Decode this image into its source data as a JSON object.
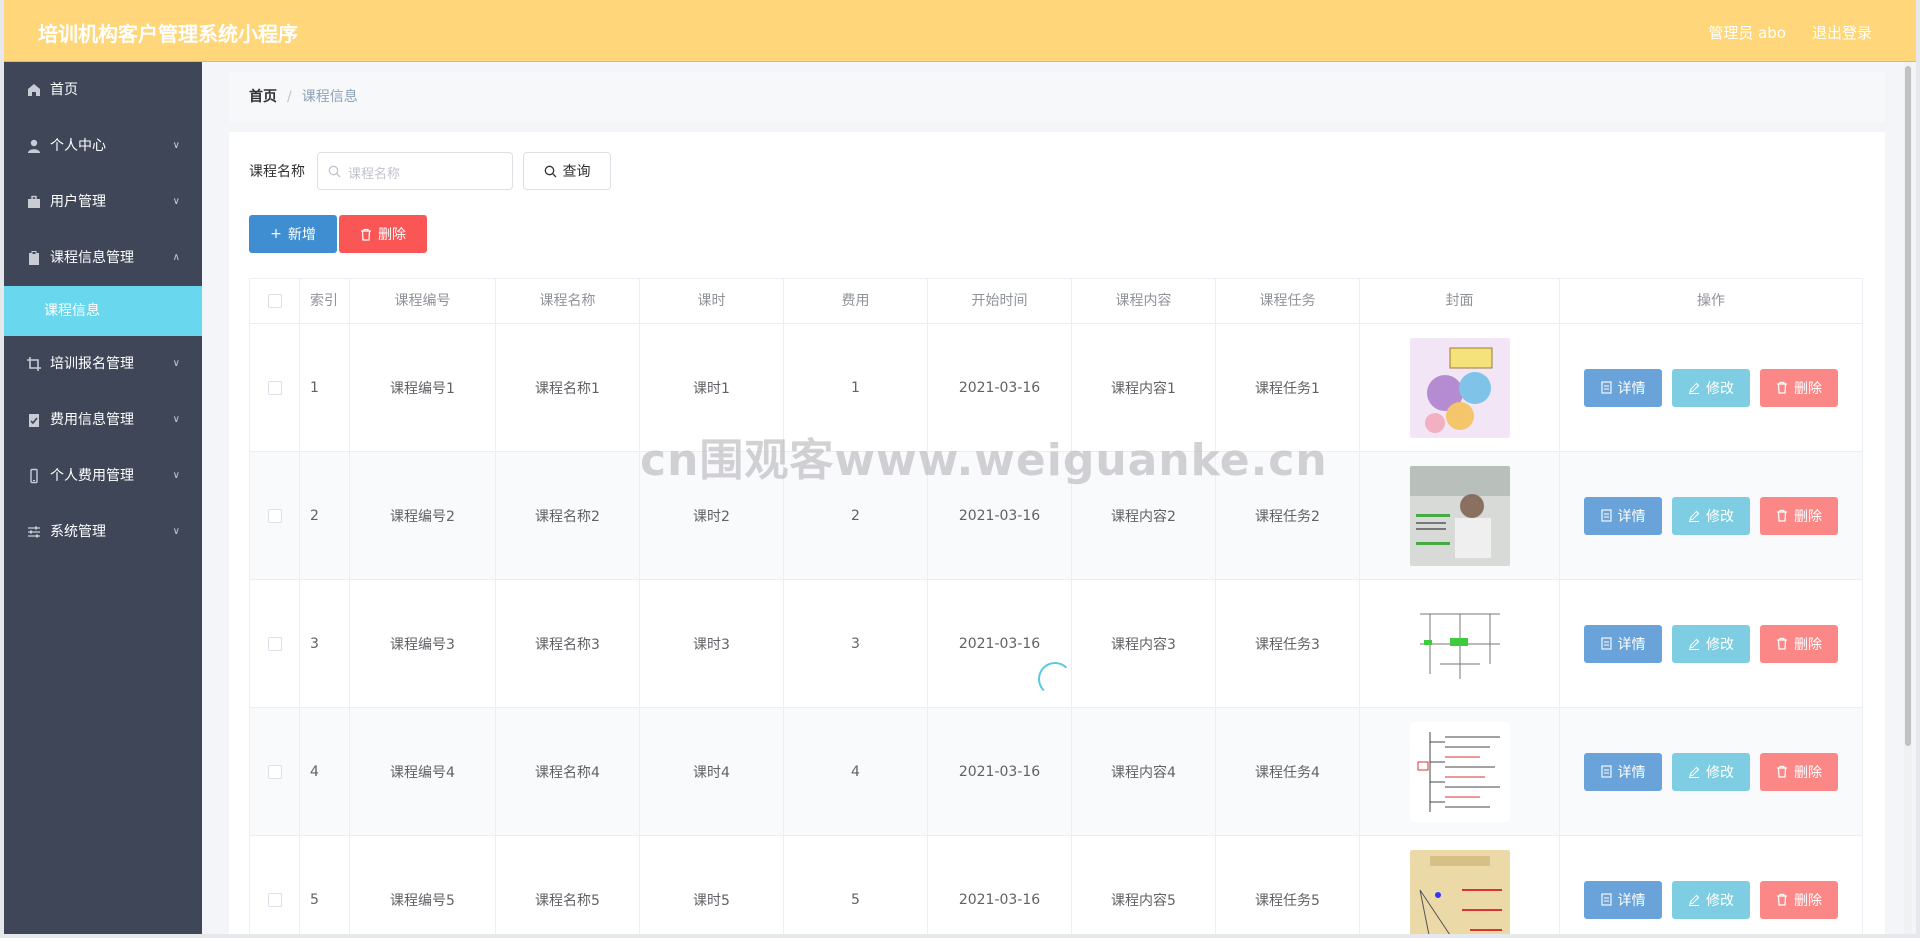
{
  "header": {
    "title": "培训机构客户管理系统小程序",
    "user": "管理员 abo",
    "logout": "退出登录"
  },
  "sidebar": {
    "items": [
      {
        "label": "首页",
        "icon": "home-icon",
        "chevron": false
      },
      {
        "label": "个人中心",
        "icon": "user-icon",
        "chevron": true
      },
      {
        "label": "用户管理",
        "icon": "briefcase-icon",
        "chevron": true
      },
      {
        "label": "课程信息管理",
        "icon": "clipboard-icon",
        "chevron": true,
        "expanded": true
      },
      {
        "label": "培训报名管理",
        "icon": "crop-icon",
        "chevron": true
      },
      {
        "label": "费用信息管理",
        "icon": "checklist-icon",
        "chevron": true
      },
      {
        "label": "个人费用管理",
        "icon": "mobile-icon",
        "chevron": true
      },
      {
        "label": "系统管理",
        "icon": "sliders-icon",
        "chevron": true
      }
    ],
    "active_sub": "课程信息"
  },
  "breadcrumb": {
    "home": "首页",
    "sep": "/",
    "current": "课程信息"
  },
  "search": {
    "label": "课程名称",
    "placeholder": "课程名称",
    "query_label": "查询"
  },
  "actions": {
    "add_label": "新增",
    "delete_label": "删除"
  },
  "table": {
    "columns": [
      "索引",
      "课程编号",
      "课程名称",
      "课时",
      "费用",
      "开始时间",
      "课程内容",
      "课程任务",
      "封面",
      "操作"
    ],
    "rows": [
      {
        "idx": "1",
        "code": "课程编号1",
        "name": "课程名称1",
        "hours": "课时1",
        "fee": "1",
        "start": "2021-03-16",
        "content": "课程内容1",
        "task": "课程任务1"
      },
      {
        "idx": "2",
        "code": "课程编号2",
        "name": "课程名称2",
        "hours": "课时2",
        "fee": "2",
        "start": "2021-03-16",
        "content": "课程内容2",
        "task": "课程任务2"
      },
      {
        "idx": "3",
        "code": "课程编号3",
        "name": "课程名称3",
        "hours": "课时3",
        "fee": "3",
        "start": "2021-03-16",
        "content": "课程内容3",
        "task": "课程任务3"
      },
      {
        "idx": "4",
        "code": "课程编号4",
        "name": "课程名称4",
        "hours": "课时4",
        "fee": "4",
        "start": "2021-03-16",
        "content": "课程内容4",
        "task": "课程任务4"
      },
      {
        "idx": "5",
        "code": "课程编号5",
        "name": "课程名称5",
        "hours": "课时5",
        "fee": "5",
        "start": "2021-03-16",
        "content": "课程内容5",
        "task": "课程任务5"
      }
    ],
    "ops": {
      "detail": "详情",
      "edit": "修改",
      "delete": "删除"
    }
  },
  "watermark": "cn围观客www.weiguanke.cn",
  "colors": {
    "header": "#ffd77a",
    "sidebar": "#3e4658",
    "submenu_active": "#69d8ee",
    "primary": "#3f8ed2",
    "danger": "#fb5656"
  }
}
